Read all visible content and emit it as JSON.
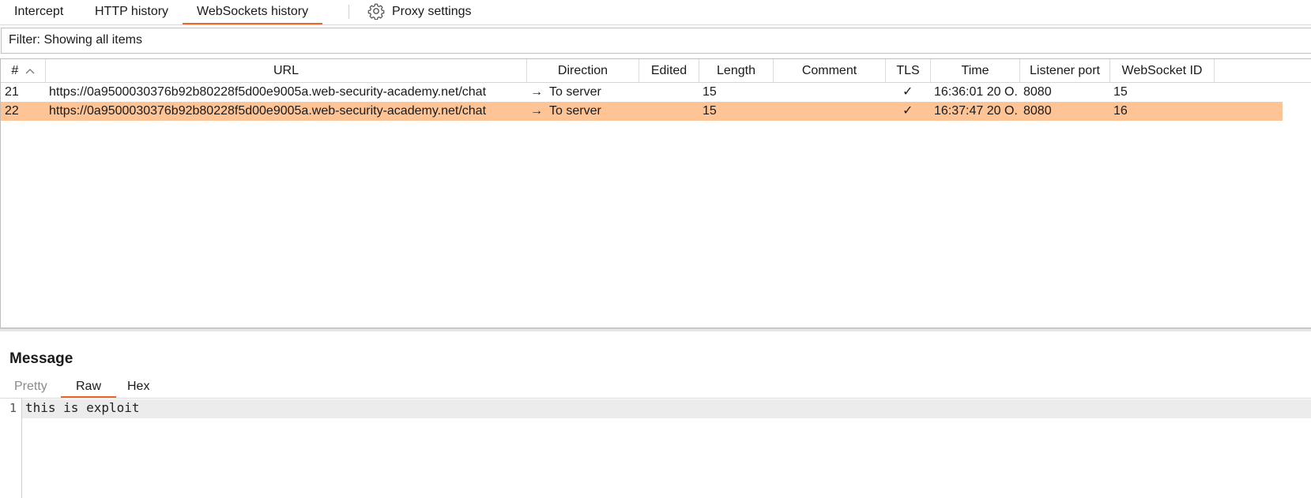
{
  "top_tabs": [
    {
      "label": "Intercept"
    },
    {
      "label": "HTTP history"
    },
    {
      "label": "WebSockets history"
    },
    {
      "label": "Proxy settings"
    }
  ],
  "filter": {
    "text": "Filter: Showing all items"
  },
  "table": {
    "columns": [
      "#",
      "URL",
      "Direction",
      "Edited",
      "Length",
      "Comment",
      "TLS",
      "Time",
      "Listener port",
      "WebSocket ID"
    ],
    "sort_indicator": "^",
    "rows": [
      {
        "num": "21",
        "url": "https://0a9500030376b92b80228f5d00e9005a.web-security-academy.net/chat",
        "direction_arrow": "→",
        "direction": "To server",
        "edited": "",
        "length": "15",
        "comment": "",
        "tls": "✓",
        "time": "16:36:01 20 O...",
        "port": "8080",
        "ws_id": "15",
        "selected": false
      },
      {
        "num": "22",
        "url": "https://0a9500030376b92b80228f5d00e9005a.web-security-academy.net/chat",
        "direction_arrow": "→",
        "direction": "To server",
        "edited": "",
        "length": "15",
        "comment": "",
        "tls": "✓",
        "time": "16:37:47 20 O...",
        "port": "8080",
        "ws_id": "16",
        "selected": true
      }
    ]
  },
  "message": {
    "title": "Message",
    "tabs": [
      {
        "label": "Pretty"
      },
      {
        "label": "Raw"
      },
      {
        "label": "Hex"
      }
    ],
    "active_tab": "Raw",
    "lines": [
      {
        "num": "1",
        "text": "this is exploit"
      }
    ]
  },
  "colors": {
    "accent": "#e8672d",
    "selected_row": "#ffc495"
  }
}
